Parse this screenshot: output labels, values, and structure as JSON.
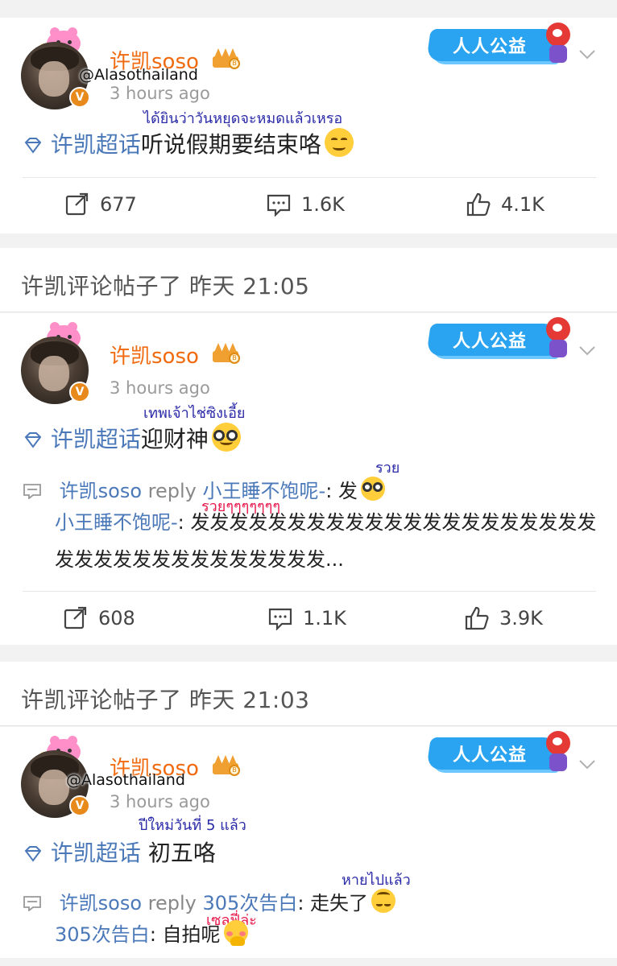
{
  "posts": [
    {
      "username": "许凯soso",
      "timestamp": "3 hours ago",
      "watermark": "@Alasothailand",
      "badge_text": "人人公益",
      "topic": "许凯超话",
      "text": "听说假期要结束咯",
      "translation": "ได้ยินว่าวันหยุดจะหมดแล้วเหรอ",
      "reposts": "677",
      "comments": "1.6K",
      "likes": "4.1K"
    },
    {
      "section_header": "许凯评论帖子了  昨天 21:05",
      "username": "许凯soso",
      "timestamp": "3 hours ago",
      "badge_text": "人人公益",
      "topic": "许凯超话",
      "text": "迎财神",
      "translation": "เทพเจ้าไช่ซิงเอี้ย",
      "reply": {
        "from": "许凯soso",
        "word": "reply",
        "to": "小王睡不饱呢-",
        "content": ": 发",
        "translation": "รวย"
      },
      "quoted": {
        "author": "小王睡不饱呢-",
        "content": ": 发发发发发发发发发发发发发发发发发发发发发发发发发发发发发发发发发发发...",
        "translation": "รวยๆๆๆๆๆๆๆ"
      },
      "reposts": "608",
      "comments": "1.1K",
      "likes": "3.9K"
    },
    {
      "section_header": "许凯评论帖子了  昨天 21:03",
      "username": "许凯soso",
      "timestamp": "3 hours ago",
      "watermark": "@Alasothailand",
      "badge_text": "人人公益",
      "topic": "许凯超话",
      "text": " 初五咯",
      "translation": "ปีใหม่วันที่ 5 แล้ว",
      "reply": {
        "from": "许凯soso",
        "word": "reply",
        "to": "305次告白",
        "content": ": 走失了",
        "translation": "หายไปแล้ว"
      },
      "quoted": {
        "author": "305次告白",
        "content": ": 自拍呢",
        "translation": "เซลฟี่ล่ะ"
      }
    }
  ],
  "colors": {
    "username": "#f06a0f",
    "topic_link": "#4a78b8",
    "thai_caption": "#2a2aa8",
    "thai_caption_alt": "#e8174a",
    "badge_blue": "#2aa3f0"
  },
  "icons": [
    "diamond-topic-icon",
    "repost-icon",
    "comment-icon",
    "like-icon",
    "chevron-down-icon",
    "crown-badge-icon",
    "verified-badge-icon",
    "smile-emoji",
    "nerd-emoji",
    "upside-down-emoji",
    "shy-emoji"
  ]
}
